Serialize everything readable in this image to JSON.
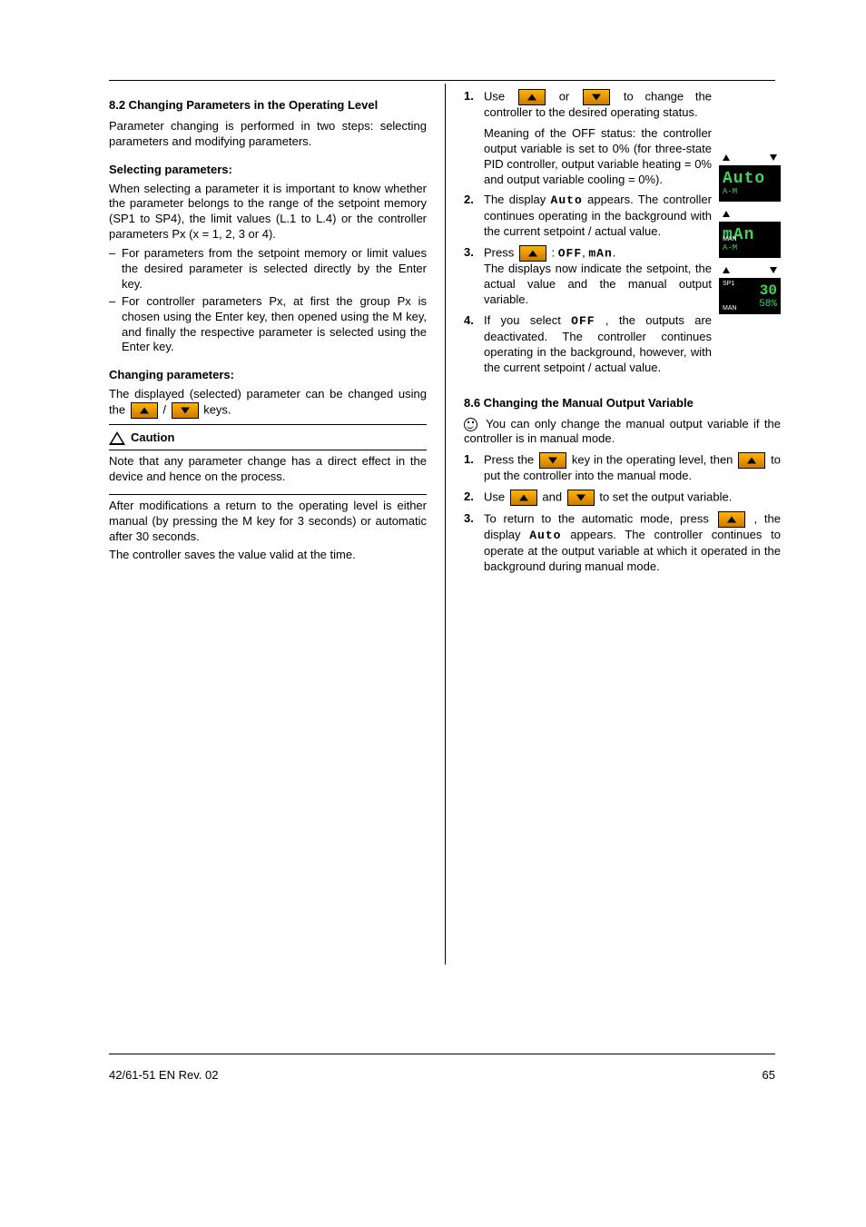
{
  "left": {
    "heading": "8.2 Changing Parameters in the Operating Level",
    "para1": "Parameter changing is performed in two steps: selecting parameters and modifying parameters.",
    "selH": "Selecting parameters:",
    "selP": "When selecting a parameter it is important to know whether the parameter belongs to the range of the setpoint memory (SP1 to SP4), the limit values (L.1 to L.4) or the controller parameters Px (x = 1, 2, 3 or 4).",
    "bullets": [
      "For parameters from the setpoint memory or limit values the desired parameter is selected directly by the Enter key.",
      "For controller parameters Px, at first the group Px is chosen using the Enter key, then opened using the M key, and finally the respective parameter is selected using the Enter key."
    ],
    "modH": "Changing parameters:",
    "modP_pre": "The displayed (selected) parameter can be changed using the ",
    "modP_mid": " /",
    "modP_post": "keys.",
    "cautionTitle": "Caution",
    "cautionBody": "Note that any parameter change has a direct effect in the device and hence on the process.",
    "paraAfter1": "After modifications a return to the operating level is either manual (by pressing the M key for 3 seconds) or automatic after 30 seconds.",
    "paraAfter2": "The controller saves the value valid at the time."
  },
  "right": {
    "firstEnum_pre": "Use",
    "firstEnum_post": "to change the controller to the desired operating status.",
    "rNote": "Meaning of the OFF status: the controller output variable is set to 0% (for three-state PID controller, output variable heating = 0% and output variable cooling = 0%).",
    "enum2_pre": "The display",
    "enum2_post": "appears. The controller continues operating in the background with the current setpoint / actual value.",
    "enum3_pre": "Press ",
    "enum3_post1": ":",
    "enum3_post2": "The displays now indicate the setpoint, the actual value and the manual output variable.",
    "enum4_pre": "If you select",
    "enum4_post": ", the outputs are deactivated. The controller continues operating in the background, however, with the current setpoint / actual value.",
    "heading86": "8.6 Changing the Manual Output Variable",
    "tip_pre": "You can only change the manual output variable if the controller is in manual mode.",
    "enumB1_pre": "Press the",
    "enumB1_mid": "key in the operating level, then",
    "enumB1_post": "to put the controller into the manual mode.",
    "enumB2_pre": "Use",
    "enumB2_mid": "and",
    "enumB2_post": "to set the output variable.",
    "enumB3_pre": "To return to the automatic mode, press",
    "enumB3_mid": ", the display",
    "enumB3_post": "appears. The controller continues to operate at the output variable at which it operated in the background during manual mode.",
    "disp1": {
      "line1": "Auto",
      "line2": "A-M"
    },
    "disp2": {
      "line1": "mAn",
      "line2": "A-M",
      "tag": "MAN"
    },
    "disp3": {
      "tag_top": "SP1",
      "num1": "30",
      "num2": "58%",
      "tag": "MAN"
    },
    "seg_auto": "Auto",
    "seg_man": "mAn",
    "seg_off": "OFF"
  },
  "footer": {
    "docid": "42/61-51 EN Rev. 02",
    "page": "65"
  }
}
